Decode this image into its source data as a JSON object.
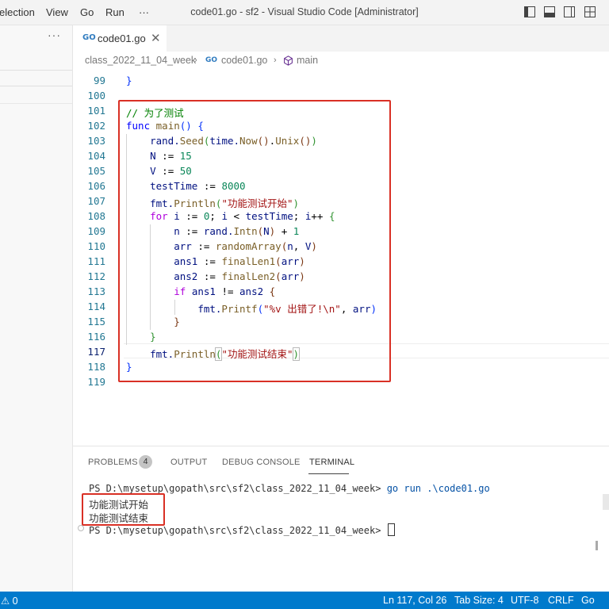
{
  "titlebar": {
    "menu": [
      "election",
      "View",
      "Go",
      "Run"
    ],
    "more": "···",
    "title": "code01.go - sf2 - Visual Studio Code [Administrator]",
    "close": "✕"
  },
  "sidebar": {
    "more": "···"
  },
  "tabs": [
    {
      "icon": "GO",
      "label": "code01.go",
      "close": "✕"
    }
  ],
  "breadcrumb": {
    "folder": "class_2022_11_04_week",
    "file_icon": "GO",
    "file": "code01.go",
    "symbol": "main"
  },
  "editor": {
    "active_line": 117,
    "lines": [
      {
        "n": "99"
      },
      {
        "n": "100"
      },
      {
        "n": "101"
      },
      {
        "n": "102"
      },
      {
        "n": "103"
      },
      {
        "n": "104"
      },
      {
        "n": "105"
      },
      {
        "n": "106"
      },
      {
        "n": "107"
      },
      {
        "n": "108"
      },
      {
        "n": "109"
      },
      {
        "n": "110"
      },
      {
        "n": "111"
      },
      {
        "n": "112"
      },
      {
        "n": "113"
      },
      {
        "n": "114"
      },
      {
        "n": "115"
      },
      {
        "n": "116"
      },
      {
        "n": "117"
      },
      {
        "n": "118"
      },
      {
        "n": "119"
      }
    ],
    "code": {
      "l99": "}",
      "l101": "// 为了测试",
      "l102_kw": "func",
      "l102_fn": "main",
      "l103_a": "rand.",
      "l103_b": "Seed",
      "l103_c": "(time.",
      "l103_d": "Now",
      "l103_e": "().",
      "l103_f": "Unix",
      "l103_g": "())",
      "l104_var": "N",
      "l104_num": "15",
      "l105_var": "V",
      "l105_num": "50",
      "l106_var": "testTime",
      "l106_num": "8000",
      "l107_fn": "Println",
      "l107_str": "\"功能测试开始\"",
      "l108_kw": "for",
      "l108_i": "i",
      "l108_num": "0",
      "l109_var": "n",
      "l109_fn": "Intn",
      "l109_num": "1",
      "l110_var": "arr",
      "l110_fn": "randomArray",
      "l111_var": "ans1",
      "l111_fn": "finalLen1",
      "l112_var": "ans2",
      "l112_fn": "finalLen2",
      "l113_kw": "if",
      "l114_fn": "Printf",
      "l114_str": "\"%v 出错了!\\n\"",
      "l117_fn": "Println",
      "l117_str": "\"功能测试结束\""
    }
  },
  "panel": {
    "tabs": [
      "PROBLEMS",
      "OUTPUT",
      "DEBUG CONSOLE",
      "TERMINAL"
    ],
    "problems_count": "4",
    "active_tab": "TERMINAL",
    "terminal": {
      "prompt1": "PS D:\\mysetup\\gopath\\src\\sf2\\class_2022_11_04_week> ",
      "command": "go run .\\code01.go",
      "out1": "功能测试开始",
      "out2": "功能测试结束",
      "prompt2": "PS D:\\mysetup\\gopath\\src\\sf2\\class_2022_11_04_week> "
    }
  },
  "statusbar": {
    "left": "⚠ 0",
    "position": "Ln 117, Col 26",
    "tab_size": "Tab Size: 4",
    "encoding": "UTF-8",
    "eol": "CRLF",
    "language": "Go",
    "bell": "🔔"
  },
  "colors": {
    "statusbar_bg": "#007acc",
    "highlight_box": "#d93025",
    "keyword": "#0000ff",
    "function": "#795e26",
    "string": "#a31515",
    "number": "#098658",
    "comment": "#008000"
  }
}
